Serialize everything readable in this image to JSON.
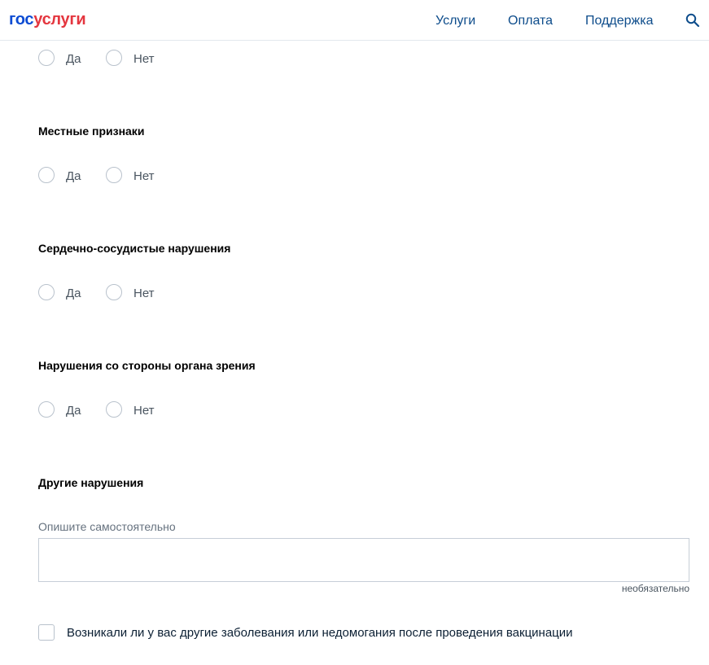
{
  "header": {
    "logo_part1": "гос",
    "logo_part2": "услуги",
    "nav": [
      "Услуги",
      "Оплата",
      "Поддержка"
    ],
    "search_icon": "search-icon"
  },
  "radio_options": {
    "yes": "Да",
    "no": "Нет"
  },
  "sections": [
    {
      "title": "Местные признаки"
    },
    {
      "title": "Сердечно-сосудистые нарушения"
    },
    {
      "title": "Нарушения со стороны органа зрения"
    },
    {
      "title": "Другие нарушения"
    }
  ],
  "other_violations": {
    "field_label": "Опишите самостоятельно",
    "value": "",
    "hint": "необязательно"
  },
  "checkbox": {
    "label": "Возникали ли у вас другие заболевания или недомогания после проведения вакцинации",
    "checked": false
  },
  "colors": {
    "brand_blue": "#0d4cd3",
    "brand_red": "#e4363f",
    "link": "#0d4c8b"
  }
}
